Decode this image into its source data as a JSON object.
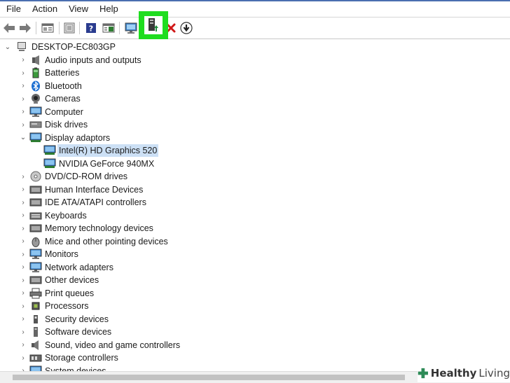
{
  "menu": [
    "File",
    "Action",
    "View",
    "Help"
  ],
  "toolbar": {
    "buttons": [
      "back-arrow-icon",
      "forward-arrow-icon",
      "properties-icon",
      "show-hide-console-icon",
      "help-icon",
      "action-pane-icon",
      "scan-hardware-icon",
      "update-driver-icon",
      "uninstall-device-icon",
      "disable-device-icon"
    ],
    "highlight_color": "#1fdd1f"
  },
  "tree": {
    "root": "DESKTOP-EC803GP",
    "categories": [
      {
        "label": "Audio inputs and outputs",
        "icon": "speaker-icon"
      },
      {
        "label": "Batteries",
        "icon": "battery-icon"
      },
      {
        "label": "Bluetooth",
        "icon": "bluetooth-icon"
      },
      {
        "label": "Cameras",
        "icon": "camera-icon"
      },
      {
        "label": "Computer",
        "icon": "computer-icon"
      },
      {
        "label": "Disk drives",
        "icon": "disk-drive-icon"
      },
      {
        "label": "Display adaptors",
        "icon": "display-adapter-icon",
        "expanded": true,
        "children": [
          {
            "label": "Intel(R) HD Graphics 520",
            "selected": true
          },
          {
            "label": "NVIDIA GeForce 940MX"
          }
        ]
      },
      {
        "label": "DVD/CD-ROM drives",
        "icon": "dvd-drive-icon"
      },
      {
        "label": "Human Interface Devices",
        "icon": "hid-icon"
      },
      {
        "label": "IDE ATA/ATAPI controllers",
        "icon": "ide-controller-icon"
      },
      {
        "label": "Keyboards",
        "icon": "keyboard-icon"
      },
      {
        "label": "Memory technology devices",
        "icon": "memory-icon"
      },
      {
        "label": "Mice and other pointing devices",
        "icon": "mouse-icon"
      },
      {
        "label": "Monitors",
        "icon": "monitor-icon"
      },
      {
        "label": "Network adapters",
        "icon": "network-icon"
      },
      {
        "label": "Other devices",
        "icon": "other-devices-icon"
      },
      {
        "label": "Print queues",
        "icon": "printer-icon"
      },
      {
        "label": "Processors",
        "icon": "processor-icon"
      },
      {
        "label": "Security devices",
        "icon": "security-icon"
      },
      {
        "label": "Software devices",
        "icon": "software-icon"
      },
      {
        "label": "Sound, video and game controllers",
        "icon": "sound-icon"
      },
      {
        "label": "Storage controllers",
        "icon": "storage-icon"
      },
      {
        "label": "System devices",
        "icon": "system-icon"
      }
    ]
  },
  "watermark": {
    "bold": "Healthy",
    "light": "Living",
    "accent": "#2e8b57"
  }
}
